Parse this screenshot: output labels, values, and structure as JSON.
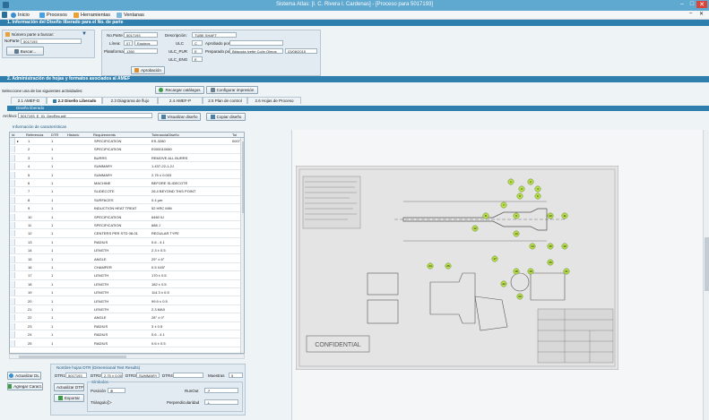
{
  "window": {
    "title": "Sistema Atlas: [I. C. Rivera I. Cardenas] - [Proceso para 5017193]",
    "controls": [
      "–",
      "□",
      "✕"
    ]
  },
  "menu": {
    "items": [
      {
        "label": "Inicio",
        "icon": "home-icon"
      },
      {
        "label": "Procesos",
        "icon": "process-icon"
      },
      {
        "label": "Herramientas",
        "icon": "tools-icon"
      },
      {
        "label": "Ventanas",
        "icon": "windows-icon"
      }
    ],
    "right_controls": [
      "–",
      "✕"
    ]
  },
  "section1": {
    "header": "1. Información del Diseño liberado para el No. de parte",
    "search_label": "Número parte a buscar:",
    "search_caption": "NoParte",
    "search_value": "5017193",
    "search_button": "Buscar...",
    "part": {
      "no_parte_label": "No.Parte:",
      "no_parte": "5017193",
      "linea_label": "Línea:",
      "linea": "07",
      "linea_name": "Equipos",
      "plataforma_label": "Plataforma:",
      "plataforma": "1350",
      "descripcion_label": "Descripción:",
      "descripcion": "TUBE SHAFT",
      "ulc_label": "ULC",
      "ulc": "C",
      "ulc_pur_label": "ULC_PUR",
      "ulc_pur": "E",
      "ulc_eng_label": "ULC_ENG",
      "ulc_eng": "E",
      "aprobado_label": "Aprobado por:",
      "aprobado": "",
      "preparado_label": "Preparado por:",
      "preparado": "Bitácoda Ivette Colín Olmos",
      "fecha": "03/08/2015",
      "approval_button": "Aprobación"
    }
  },
  "section2": {
    "header": "2. Administración de hojas y formatos asociados al AMEF",
    "select_label": "Seleccione una de las siguientes actividades:",
    "reload_button": "Recargar catálogos",
    "config_button": "Configurar impresión",
    "tabs": [
      "2.1 AMEF-D",
      "2.2 Diseño Liberado",
      "2.3 Diagrama de flujo",
      "2.4 AMEF-P",
      "2.5 Plan de control",
      "2.6 Hojas de Proceso"
    ],
    "active_tab": "2.2 Diseño Liberado",
    "subheader": "Diseño liberado",
    "archivo_label": "Archivo:",
    "archivo": "5017193_E_01_DepRec.pdf",
    "view_button": "Visualizar diseño",
    "copy_button": "Copiar diseño",
    "group_label": "Información de características"
  },
  "grid": {
    "columns": [
      "Id",
      "Referencia",
      "DTR",
      "Historic",
      "Requirements",
      "ToleranciaDiseño",
      "Tol"
    ],
    "rows": [
      {
        "ref": "1",
        "dtr": "1",
        "req": "SPECIFICATION",
        "tol": "ES-3280",
        "t": "0007"
      },
      {
        "ref": "2",
        "dtr": "1",
        "req": "SPECIFICATION",
        "tol": "E000010080",
        "t": ""
      },
      {
        "ref": "3",
        "dtr": "1",
        "req": "BURRS",
        "tol": "REMOVE ALL BURRS",
        "t": ""
      },
      {
        "ref": "4",
        "dtr": "1",
        "req": "SUMMARY",
        "tol": "1.437-22-1-2J",
        "t": ""
      },
      {
        "ref": "5",
        "dtr": "1",
        "req": "SUMMARY",
        "tol": "2.75 ± 0.003",
        "t": ""
      },
      {
        "ref": "6",
        "dtr": "1",
        "req": "MACHINE",
        "tol": "BEFORE SLIDECOTE",
        "t": ""
      },
      {
        "ref": "7",
        "dtr": "1",
        "req": "SLIDECOTE",
        "tol": "26.4 BEYOND THIS POINT",
        "t": ""
      },
      {
        "ref": "8",
        "dtr": "1",
        "req": "SURFACES",
        "tol": "0.4 µm",
        "t": ""
      },
      {
        "ref": "9",
        "dtr": "1",
        "req": "INDUCTION HEAT TREAT",
        "tol": "52 HRC MIN",
        "t": ""
      },
      {
        "ref": "10",
        "dtr": "1",
        "req": "SPECIFICATION",
        "tol": "6460 IU",
        "t": ""
      },
      {
        "ref": "11",
        "dtr": "1",
        "req": "SPECIFICATION",
        "tol": "688 J",
        "t": ""
      },
      {
        "ref": "12",
        "dtr": "1",
        "req": "CENTERS PER STD 08-01",
        "tol": "REGULAR TYPE",
        "t": ""
      },
      {
        "ref": "13",
        "dtr": "1",
        "req": "RADIUS",
        "tol": "0.6 - 4.1",
        "t": ""
      },
      {
        "ref": "14",
        "dtr": "1",
        "req": "LENGTH",
        "tol": "2.3 ± 0.5",
        "t": ""
      },
      {
        "ref": "15",
        "dtr": "1",
        "req": "ANGLE",
        "tol": "29° ± 6°",
        "t": ""
      },
      {
        "ref": "16",
        "dtr": "1",
        "req": "CHAMFER",
        "tol": "0.5 X45°",
        "t": ""
      },
      {
        "ref": "17",
        "dtr": "1",
        "req": "LENGTH",
        "tol": "170 ± 0.5",
        "t": ""
      },
      {
        "ref": "18",
        "dtr": "1",
        "req": "LENGTH",
        "tol": "182 ± 0.5",
        "t": ""
      },
      {
        "ref": "19",
        "dtr": "1",
        "req": "LENGTH",
        "tol": "114.3 ± 0.5",
        "t": ""
      },
      {
        "ref": "20",
        "dtr": "1",
        "req": "LENGTH",
        "tol": "99.9 ± 0.5",
        "t": ""
      },
      {
        "ref": "21",
        "dtr": "1",
        "req": "LENGTH",
        "tol": "2.3 MAX",
        "t": ""
      },
      {
        "ref": "22",
        "dtr": "1",
        "req": "ANGLE",
        "tol": "28° ± 0°",
        "t": ""
      },
      {
        "ref": "23",
        "dtr": "1",
        "req": "RADIUS",
        "tol": "3 ± 0.5",
        "t": ""
      },
      {
        "ref": "24",
        "dtr": "1",
        "req": "RADIUS",
        "tol": "0.6 - 4.1",
        "t": ""
      },
      {
        "ref": "25",
        "dtr": "1",
        "req": "RADIUS",
        "tol": "0.6 ± 0.5",
        "t": ""
      }
    ]
  },
  "bottom": {
    "update_dtr_button": "Actualizar DL",
    "add_char_button": "Agregar Caract.",
    "update_dtp_button": "Actualizar DTP",
    "export_button": "Exportar",
    "group_label": "Nombre hojas DTR (Dimensional Test Results)",
    "dtr1_label": "DTR1",
    "dtr1": "5017193",
    "dtr2_label": "DTR2",
    "dtr2": "2.75 ± 0.003",
    "dtr3_label": "DTR3",
    "dtr3": "SUMMARY",
    "dtr4_label": "DTR4",
    "dtr4": "",
    "muestras_label": "Muestras",
    "muestras": "5",
    "symbols_label": "Símbolos",
    "posicion_label": "Posición",
    "runout_label": "RunOut",
    "triangulo_label": "Triángulo",
    "perpendicularidad_label": "Perpendicularidad"
  },
  "drawing": {
    "stamp": "CONFIDENTIAL",
    "balloons": [
      "1",
      "2",
      "3",
      "4",
      "5",
      "6",
      "7",
      "8",
      "9",
      "10",
      "11",
      "12",
      "13",
      "14",
      "15",
      "16",
      "17",
      "18",
      "19",
      "20",
      "21",
      "22",
      "23",
      "24",
      "25"
    ]
  },
  "colors": {
    "title_bar": "#5fa8cf",
    "section_header": "#2f7fae",
    "balloon": "#b8e04a"
  }
}
